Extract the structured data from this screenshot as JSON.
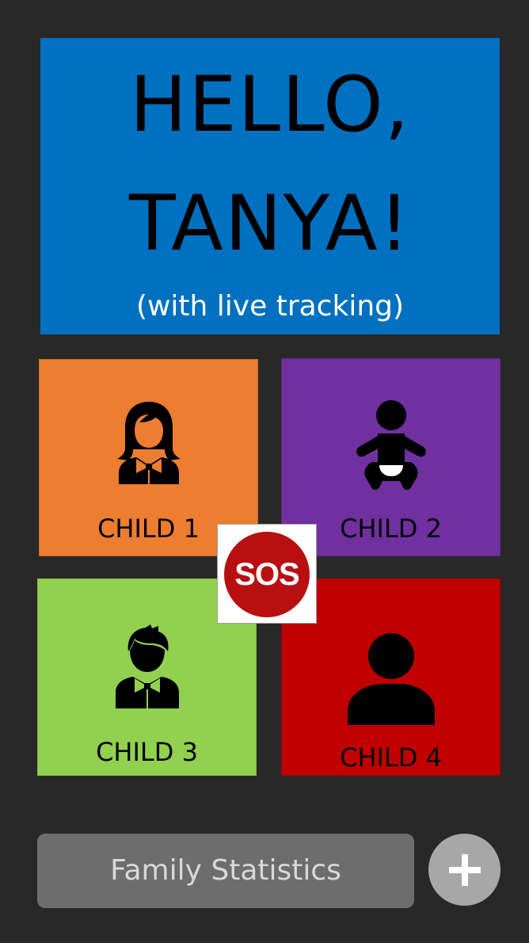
{
  "header": {
    "line1": "HELLO,",
    "line2": "TANYA!",
    "subtitle": "(with live tracking)",
    "background": "#0070c0"
  },
  "children": [
    {
      "label": "CHILD 1",
      "icon": "girl-icon",
      "color": "#ed7d31"
    },
    {
      "label": "CHILD 2",
      "icon": "baby-icon",
      "color": "#7030a0"
    },
    {
      "label": "CHILD 3",
      "icon": "boy-icon",
      "color": "#92d050"
    },
    {
      "label": "CHILD 4",
      "icon": "person-icon",
      "color": "#c00000"
    }
  ],
  "sos": {
    "label": "SOS",
    "color": "#b80f10"
  },
  "footer": {
    "stats_label": "Family Statistics",
    "add_icon": "plus-icon"
  }
}
